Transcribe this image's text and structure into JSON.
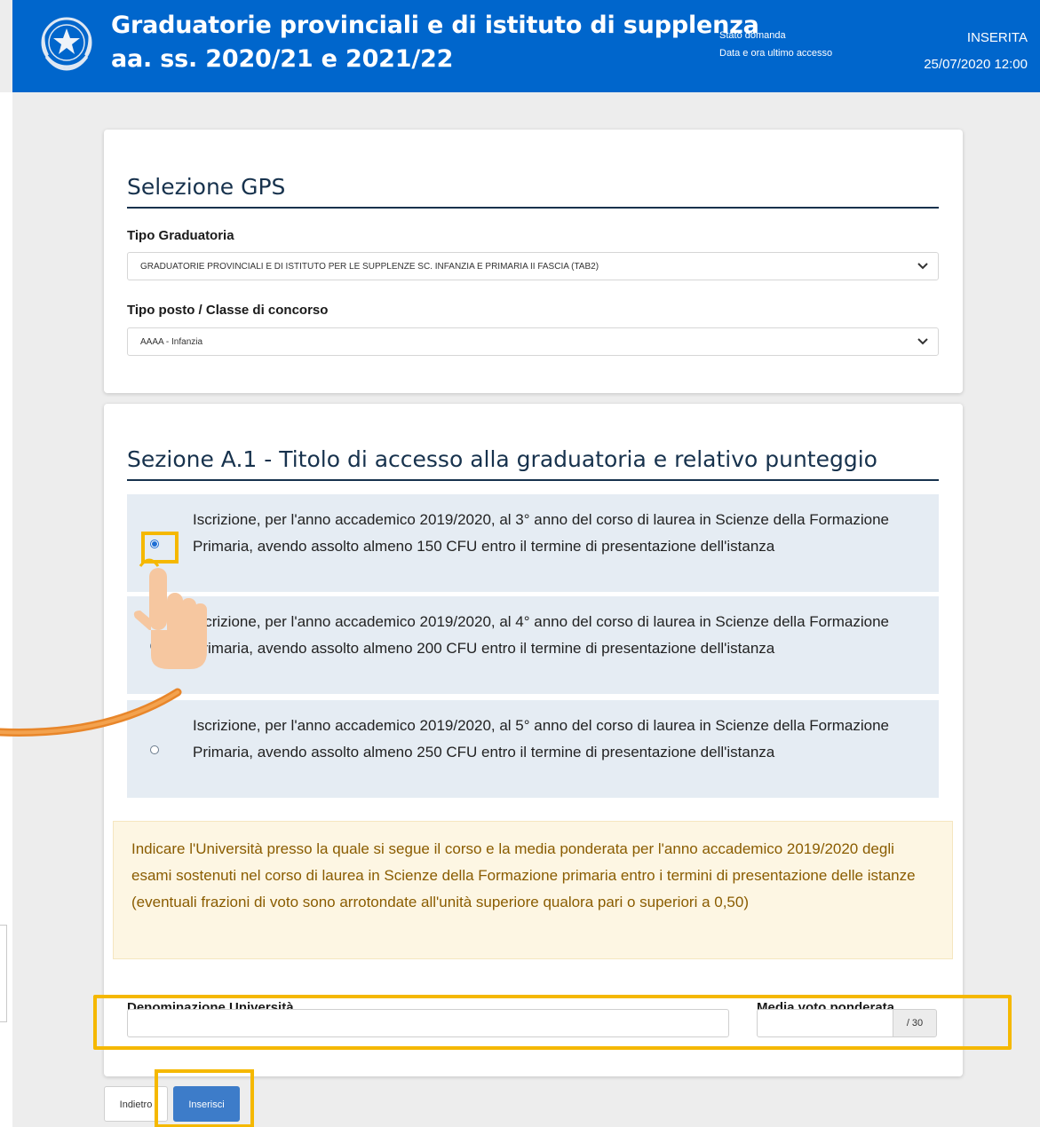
{
  "header": {
    "title_line1": "Graduatorie provinciali e di istituto di supplenza",
    "title_line2": "aa. ss. 2020/21 e 2021/22",
    "status_label": "Stato domanda",
    "status_value": "INSERITA",
    "access_label": "Data e ora ultimo accesso",
    "access_value": "25/07/2020 12:00",
    "emblem_icon": "italian-republic-emblem-icon"
  },
  "gps": {
    "title": "Selezione GPS",
    "tipo_graduatoria_label": "Tipo Graduatoria",
    "tipo_graduatoria_value": "GRADUATORIE PROVINCIALI E DI ISTITUTO PER LE SUPPLENZE SC. INFANZIA E PRIMARIA II FASCIA (TAB2)",
    "tipo_posto_label": "Tipo posto / Classe di concorso",
    "tipo_posto_value": "AAAA - Infanzia"
  },
  "section_a1": {
    "title": "Sezione A.1 - Titolo di accesso alla graduatoria e relativo punteggio",
    "options": [
      {
        "text": "Iscrizione, per l'anno accademico 2019/2020, al 3° anno del corso di laurea in Scienze della Formazione Primaria, avendo assolto almeno 150 CFU entro il termine di presentazione dell'istanza",
        "selected": true
      },
      {
        "text": "Iscrizione, per l'anno accademico 2019/2020, al 4° anno del corso di laurea in Scienze della Formazione Primaria, avendo assolto almeno 200 CFU entro il termine di presentazione dell'istanza",
        "selected": false
      },
      {
        "text": "Iscrizione, per l'anno accademico 2019/2020, al 5° anno del corso di laurea in Scienze della Formazione Primaria, avendo assolto almeno 250 CFU entro il termine di presentazione dell'istanza",
        "selected": false
      }
    ],
    "notice": "Indicare l'Università presso la quale si segue il corso e la media ponderata per l'anno accademico 2019/2020 degli esami sostenuti nel corso di laurea in Scienze della Formazione primaria entro i termini di presentazione delle istanze (eventuali frazioni di voto sono arrotondate all'unità superiore qualora pari o superiori a 0,50)",
    "universita_label": "Denominazione Università",
    "universita_value": "",
    "media_label": "Media voto ponderata",
    "media_value": "",
    "media_suffix": "/ 30"
  },
  "buttons": {
    "back_label": "Indietro",
    "insert_label": "Inserisci"
  },
  "colors": {
    "header_bg": "#0066cc",
    "highlight": "#f5b800",
    "option_bg": "#e5ecf3",
    "notice_text": "#8a5c00",
    "primary_button": "#3d7cc9"
  }
}
